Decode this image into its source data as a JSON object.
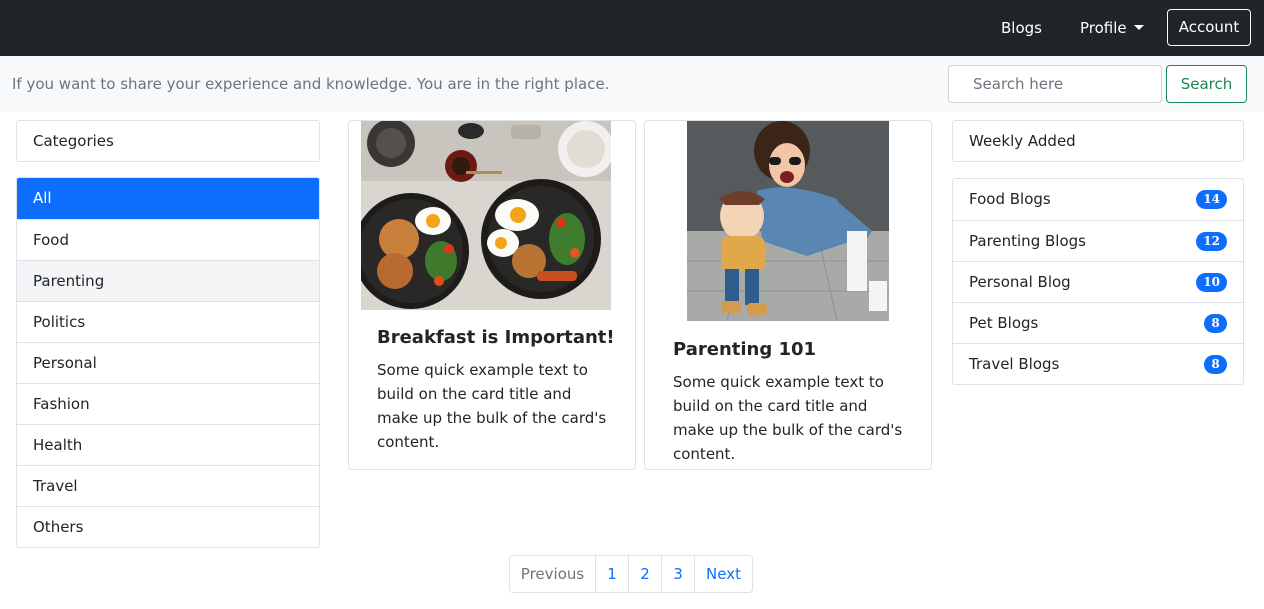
{
  "navbar": {
    "blogs_label": "Blogs",
    "profile_label": "Profile",
    "account_label": "Account"
  },
  "subbar": {
    "tagline": "If you want to share your experience and knowledge. You are in the right place.",
    "search_placeholder": "Search here",
    "search_button": "Search"
  },
  "categories": {
    "title": "Categories",
    "items": [
      "All",
      "Food",
      "Parenting",
      "Politics",
      "Personal",
      "Fashion",
      "Health",
      "Travel",
      "Others"
    ],
    "active": "All"
  },
  "cards": [
    {
      "title": "Breakfast is Important!",
      "text": "Some quick example text to build on the card title and make up the bulk of the card's content.",
      "image_icon": "breakfast-plates-photo"
    },
    {
      "title": "Parenting 101",
      "text": "Some quick example text to build on the card title and make up the bulk of the card's content.",
      "image_icon": "mother-and-child-photo"
    }
  ],
  "weekly": {
    "title": "Weekly Added",
    "items": [
      {
        "label": "Food Blogs",
        "count": "14"
      },
      {
        "label": "Parenting Blogs",
        "count": "12"
      },
      {
        "label": "Personal Blog",
        "count": "10"
      },
      {
        "label": "Pet Blogs",
        "count": "8"
      },
      {
        "label": "Travel Blogs",
        "count": "8"
      }
    ]
  },
  "pagination": {
    "previous": "Previous",
    "pages": [
      "1",
      "2",
      "3"
    ],
    "next": "Next"
  },
  "colors": {
    "navbar_bg": "#212529",
    "primary": "#0d6efd",
    "success": "#198754",
    "muted": "#6c757d"
  }
}
